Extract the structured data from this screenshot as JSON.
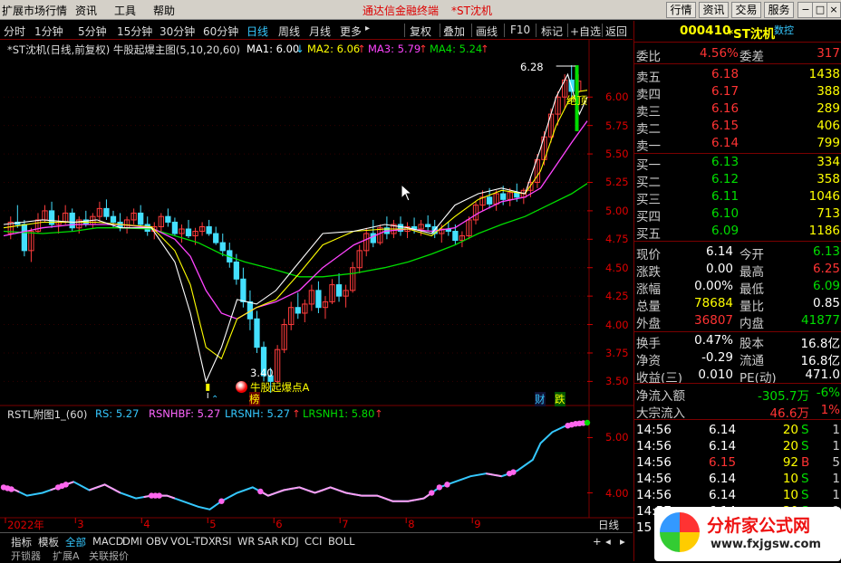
{
  "menubar": {
    "items": [
      "扩展市场行情",
      "资讯",
      "工具",
      "帮助"
    ],
    "title": "通达信金融终端",
    "stock_title": "*ST沈机",
    "buttons": [
      "行情",
      "资讯",
      "交易",
      "服务"
    ],
    "window_controls": [
      "−",
      "□",
      "×"
    ]
  },
  "toolbar": {
    "periods": [
      "分时",
      "1分钟",
      "5分钟",
      "15分钟",
      "30分钟",
      "60分钟",
      "日线",
      "周线",
      "月线",
      "更多"
    ],
    "active_period": "日线",
    "more_arrow": "▸",
    "actions": [
      "复权",
      "叠加",
      "画线",
      "F10",
      "标记",
      "+自选",
      "返回"
    ]
  },
  "main_legend": {
    "title": "*ST沈机(日线,前复权) 牛股起爆主图(5,10,20,60)",
    "ma1": "MA1: 6.00",
    "ma1_arrow": "↓",
    "ma2": "MA2: 6.06",
    "ma2_arrow": "↑",
    "ma3": "MA3: 5.79",
    "ma3_arrow": "↑",
    "ma4": "MA4: 5.24",
    "ma4_arrow": "↑"
  },
  "annotations": {
    "high": "6.28",
    "low": "3.40",
    "signal": "牛股起爆点A",
    "top_tag": "绝顶",
    "bang": "榜",
    "cai": "财",
    "die": "跌"
  },
  "sub_legend": {
    "title": "RSTL附图1_(60)",
    "rs": "RS: 5.27",
    "rsnhbf": "RSNHBF: 5.27",
    "lrsnh": "LRSNH: 5.27",
    "lrsnh_arrow": "↑",
    "lrsnh1": "LRSNH1: 5.80",
    "lrsnh1_arrow": "↑"
  },
  "colors": {
    "up": "#ff3c3c",
    "down": "#44e0ff",
    "ma1": "#ffffff",
    "ma2": "#ffff00",
    "ma3": "#ff44ff",
    "ma4": "#00dd00",
    "axis": "#cc0000"
  },
  "chart_data": {
    "type": "candlestick",
    "price_axis": {
      "ticks": [
        "6.00",
        "5.75",
        "5.50",
        "5.25",
        "5.00",
        "4.75",
        "4.50",
        "4.25",
        "4.00",
        "3.75",
        "3.50"
      ],
      "range": [
        3.4,
        6.28
      ]
    },
    "sub_axis": {
      "ticks": [
        "5.00",
        "4.00"
      ]
    },
    "x_axis": {
      "labels": [
        "2022年",
        "3",
        "4",
        "5",
        "6",
        "7",
        "8",
        "9"
      ],
      "period_label": "日线"
    },
    "ma1_points": [
      [
        0,
        4.88
      ],
      [
        10,
        4.92
      ],
      [
        18,
        4.9
      ],
      [
        24,
        4.92
      ],
      [
        30,
        4.85
      ],
      [
        38,
        4.85
      ],
      [
        44,
        4.55
      ],
      [
        48,
        4.1
      ],
      [
        52,
        3.5
      ],
      [
        56,
        3.8
      ],
      [
        60,
        4.22
      ],
      [
        65,
        4.18
      ],
      [
        70,
        4.3
      ],
      [
        76,
        4.55
      ],
      [
        82,
        4.8
      ],
      [
        90,
        4.82
      ],
      [
        98,
        4.88
      ],
      [
        104,
        4.85
      ],
      [
        110,
        4.8
      ],
      [
        116,
        5.05
      ],
      [
        122,
        5.15
      ],
      [
        128,
        5.2
      ],
      [
        134,
        5.15
      ],
      [
        138,
        5.55
      ],
      [
        142,
        6.0
      ],
      [
        145,
        6.2
      ],
      [
        148,
        5.85
      ],
      [
        150,
        6.0
      ]
    ],
    "ma2_points": [
      [
        0,
        4.85
      ],
      [
        10,
        4.9
      ],
      [
        18,
        4.9
      ],
      [
        24,
        4.9
      ],
      [
        30,
        4.88
      ],
      [
        38,
        4.86
      ],
      [
        44,
        4.65
      ],
      [
        48,
        4.35
      ],
      [
        52,
        3.8
      ],
      [
        56,
        3.7
      ],
      [
        60,
        4.05
      ],
      [
        65,
        4.15
      ],
      [
        70,
        4.22
      ],
      [
        76,
        4.45
      ],
      [
        82,
        4.7
      ],
      [
        90,
        4.82
      ],
      [
        98,
        4.84
      ],
      [
        104,
        4.84
      ],
      [
        110,
        4.78
      ],
      [
        116,
        4.95
      ],
      [
        122,
        5.1
      ],
      [
        128,
        5.18
      ],
      [
        134,
        5.15
      ],
      [
        138,
        5.35
      ],
      [
        142,
        5.75
      ],
      [
        145,
        5.95
      ],
      [
        148,
        6.05
      ],
      [
        150,
        6.06
      ]
    ],
    "ma3_points": [
      [
        0,
        4.78
      ],
      [
        10,
        4.85
      ],
      [
        18,
        4.88
      ],
      [
        24,
        4.88
      ],
      [
        30,
        4.88
      ],
      [
        38,
        4.85
      ],
      [
        44,
        4.75
      ],
      [
        48,
        4.6
      ],
      [
        52,
        4.3
      ],
      [
        56,
        4.1
      ],
      [
        60,
        4.05
      ],
      [
        65,
        4.15
      ],
      [
        70,
        4.2
      ],
      [
        76,
        4.3
      ],
      [
        82,
        4.5
      ],
      [
        90,
        4.7
      ],
      [
        98,
        4.82
      ],
      [
        104,
        4.84
      ],
      [
        110,
        4.82
      ],
      [
        116,
        4.85
      ],
      [
        122,
        4.98
      ],
      [
        128,
        5.08
      ],
      [
        134,
        5.12
      ],
      [
        138,
        5.2
      ],
      [
        142,
        5.4
      ],
      [
        146,
        5.6
      ],
      [
        150,
        5.79
      ]
    ],
    "ma4_points": [
      [
        0,
        4.82
      ],
      [
        10,
        4.8
      ],
      [
        18,
        4.82
      ],
      [
        24,
        4.85
      ],
      [
        30,
        4.85
      ],
      [
        38,
        4.84
      ],
      [
        44,
        4.78
      ],
      [
        50,
        4.72
      ],
      [
        56,
        4.62
      ],
      [
        62,
        4.55
      ],
      [
        70,
        4.48
      ],
      [
        76,
        4.42
      ],
      [
        82,
        4.42
      ],
      [
        90,
        4.45
      ],
      [
        98,
        4.5
      ],
      [
        104,
        4.55
      ],
      [
        110,
        4.62
      ],
      [
        116,
        4.7
      ],
      [
        122,
        4.8
      ],
      [
        128,
        4.88
      ],
      [
        134,
        4.95
      ],
      [
        140,
        5.05
      ],
      [
        146,
        5.15
      ],
      [
        150,
        5.24
      ]
    ],
    "ohlc": [
      [
        4.8,
        4.95,
        4.75,
        4.9
      ],
      [
        4.9,
        5.05,
        4.85,
        4.88
      ],
      [
        4.88,
        4.92,
        4.6,
        4.65
      ],
      [
        4.65,
        4.85,
        4.55,
        4.82
      ],
      [
        4.82,
        4.98,
        4.8,
        4.92
      ],
      [
        4.92,
        5.05,
        4.9,
        5.0
      ],
      [
        5.0,
        5.08,
        4.85,
        4.88
      ],
      [
        4.88,
        4.96,
        4.8,
        4.9
      ],
      [
        4.9,
        5.05,
        4.88,
        4.98
      ],
      [
        4.98,
        5.02,
        4.82,
        4.85
      ],
      [
        4.85,
        4.95,
        4.8,
        4.92
      ],
      [
        4.92,
        5.0,
        4.86,
        4.88
      ],
      [
        4.88,
        4.98,
        4.84,
        4.95
      ],
      [
        4.95,
        5.08,
        4.9,
        5.02
      ],
      [
        5.02,
        5.1,
        4.92,
        4.95
      ],
      [
        4.95,
        5.0,
        4.85,
        4.9
      ],
      [
        4.9,
        4.98,
        4.82,
        4.85
      ],
      [
        4.85,
        4.95,
        4.8,
        4.92
      ],
      [
        4.92,
        5.02,
        4.88,
        4.98
      ],
      [
        4.98,
        5.05,
        4.86,
        4.88
      ],
      [
        4.88,
        4.95,
        4.78,
        4.82
      ],
      [
        4.82,
        4.9,
        4.75,
        4.86
      ],
      [
        4.86,
        4.98,
        4.82,
        4.95
      ],
      [
        4.95,
        5.02,
        4.86,
        4.9
      ],
      [
        4.9,
        4.94,
        4.78,
        4.8
      ],
      [
        4.8,
        4.88,
        4.72,
        4.84
      ],
      [
        4.84,
        4.92,
        4.76,
        4.78
      ],
      [
        4.78,
        4.85,
        4.7,
        4.82
      ],
      [
        4.82,
        4.9,
        4.78,
        4.86
      ],
      [
        4.86,
        4.92,
        4.78,
        4.8
      ],
      [
        4.8,
        4.86,
        4.7,
        4.72
      ],
      [
        4.72,
        4.8,
        4.6,
        4.65
      ],
      [
        4.65,
        4.72,
        4.5,
        4.55
      ],
      [
        4.55,
        4.62,
        4.35,
        4.4
      ],
      [
        4.4,
        4.5,
        4.15,
        4.2
      ],
      [
        4.2,
        4.3,
        3.95,
        4.05
      ],
      [
        4.05,
        4.12,
        3.75,
        3.8
      ],
      [
        3.8,
        3.85,
        3.5,
        3.55
      ],
      [
        3.55,
        3.62,
        3.4,
        3.5
      ],
      [
        3.5,
        3.82,
        3.48,
        3.78
      ],
      [
        3.78,
        4.05,
        3.75,
        4.0
      ],
      [
        4.0,
        4.2,
        3.95,
        4.15
      ],
      [
        4.15,
        4.28,
        4.05,
        4.1
      ],
      [
        4.1,
        4.22,
        4.02,
        4.18
      ],
      [
        4.18,
        4.35,
        4.12,
        4.3
      ],
      [
        4.3,
        4.38,
        4.1,
        4.15
      ],
      [
        4.15,
        4.25,
        4.05,
        4.2
      ],
      [
        4.2,
        4.4,
        4.18,
        4.35
      ],
      [
        4.35,
        4.45,
        4.2,
        4.25
      ],
      [
        4.25,
        4.35,
        4.15,
        4.3
      ],
      [
        4.3,
        4.55,
        4.28,
        4.5
      ],
      [
        4.5,
        4.7,
        4.45,
        4.65
      ],
      [
        4.65,
        4.85,
        4.6,
        4.8
      ],
      [
        4.8,
        4.92,
        4.68,
        4.72
      ],
      [
        4.72,
        4.88,
        4.7,
        4.85
      ],
      [
        4.85,
        4.95,
        4.75,
        4.8
      ],
      [
        4.8,
        4.92,
        4.76,
        4.88
      ],
      [
        4.88,
        4.95,
        4.78,
        4.82
      ],
      [
        4.82,
        4.9,
        4.76,
        4.86
      ],
      [
        4.86,
        4.94,
        4.8,
        4.84
      ],
      [
        4.84,
        4.92,
        4.78,
        4.88
      ],
      [
        4.88,
        4.96,
        4.82,
        4.86
      ],
      [
        4.86,
        4.92,
        4.76,
        4.8
      ],
      [
        4.8,
        4.88,
        4.72,
        4.84
      ],
      [
        4.84,
        4.9,
        4.78,
        4.82
      ],
      [
        4.82,
        4.88,
        4.7,
        4.74
      ],
      [
        4.74,
        4.82,
        4.68,
        4.78
      ],
      [
        4.78,
        4.95,
        4.75,
        4.92
      ],
      [
        4.92,
        5.08,
        4.88,
        5.05
      ],
      [
        5.05,
        5.18,
        5.0,
        5.12
      ],
      [
        5.12,
        5.2,
        5.02,
        5.06
      ],
      [
        5.06,
        5.18,
        5.0,
        5.15
      ],
      [
        5.15,
        5.22,
        5.05,
        5.1
      ],
      [
        5.1,
        5.2,
        5.04,
        5.16
      ],
      [
        5.16,
        5.24,
        5.08,
        5.12
      ],
      [
        5.12,
        5.2,
        5.06,
        5.18
      ],
      [
        5.18,
        5.3,
        5.12,
        5.25
      ],
      [
        5.25,
        5.5,
        5.2,
        5.45
      ],
      [
        5.45,
        5.7,
        5.4,
        5.65
      ],
      [
        5.65,
        5.9,
        5.6,
        5.85
      ],
      [
        5.85,
        6.05,
        5.75,
        6.0
      ],
      [
        6.0,
        6.2,
        5.9,
        6.15
      ],
      [
        6.15,
        6.28,
        5.95,
        6.05
      ],
      [
        6.05,
        6.2,
        5.85,
        6.14
      ]
    ],
    "sub_points": [
      [
        0,
        4.1
      ],
      [
        3,
        4.05
      ],
      [
        6,
        3.95
      ],
      [
        10,
        4.0
      ],
      [
        14,
        4.1
      ],
      [
        18,
        4.2
      ],
      [
        22,
        4.05
      ],
      [
        26,
        4.15
      ],
      [
        30,
        4.0
      ],
      [
        34,
        3.9
      ],
      [
        38,
        3.95
      ],
      [
        42,
        3.95
      ],
      [
        46,
        3.85
      ],
      [
        50,
        3.75
      ],
      [
        53,
        3.7
      ],
      [
        56,
        3.85
      ],
      [
        60,
        4.0
      ],
      [
        64,
        4.1
      ],
      [
        68,
        3.95
      ],
      [
        72,
        4.05
      ],
      [
        76,
        4.1
      ],
      [
        80,
        4.0
      ],
      [
        84,
        4.1
      ],
      [
        88,
        4.0
      ],
      [
        92,
        3.95
      ],
      [
        96,
        3.95
      ],
      [
        100,
        3.85
      ],
      [
        104,
        3.85
      ],
      [
        108,
        3.9
      ],
      [
        112,
        4.1
      ],
      [
        116,
        4.2
      ],
      [
        120,
        4.3
      ],
      [
        124,
        4.35
      ],
      [
        128,
        4.3
      ],
      [
        132,
        4.4
      ],
      [
        136,
        4.6
      ],
      [
        138,
        4.9
      ],
      [
        141,
        5.1
      ],
      [
        144,
        5.2
      ],
      [
        147,
        5.25
      ],
      [
        150,
        5.27
      ]
    ],
    "sub_highlights": [
      0,
      1,
      2,
      14,
      15,
      16,
      38,
      39,
      40,
      56,
      66,
      110,
      112,
      114,
      130,
      131,
      145,
      146,
      147,
      148,
      149,
      150
    ]
  },
  "right_panel": {
    "code": "000410",
    "name": "*ST沈机",
    "tag": "数控",
    "weibi_label": "委比",
    "weibi": "4.56%",
    "weicha_label": "委差",
    "weicha": "317",
    "asks": [
      {
        "label": "卖五",
        "price": "6.18",
        "vol": "1438"
      },
      {
        "label": "卖四",
        "price": "6.17",
        "vol": "388"
      },
      {
        "label": "卖三",
        "price": "6.16",
        "vol": "289"
      },
      {
        "label": "卖二",
        "price": "6.15",
        "vol": "406"
      },
      {
        "label": "卖一",
        "price": "6.14",
        "vol": "799"
      }
    ],
    "bids": [
      {
        "label": "买一",
        "price": "6.13",
        "vol": "334"
      },
      {
        "label": "买二",
        "price": "6.12",
        "vol": "358"
      },
      {
        "label": "买三",
        "price": "6.11",
        "vol": "1046"
      },
      {
        "label": "买四",
        "price": "6.10",
        "vol": "713"
      },
      {
        "label": "买五",
        "price": "6.09",
        "vol": "1186"
      }
    ],
    "stats": [
      {
        "l1": "现价",
        "v1": "6.14",
        "l2": "今开",
        "v2": "6.13"
      },
      {
        "l1": "涨跌",
        "v1": "0.00",
        "l2": "最高",
        "v2": "6.25"
      },
      {
        "l1": "涨幅",
        "v1": "0.00%",
        "l2": "最低",
        "v2": "6.09"
      },
      {
        "l1": "总量",
        "v1": "78684",
        "l2": "量比",
        "v2": "0.85"
      },
      {
        "l1": "外盘",
        "v1": "36807",
        "l2": "内盘",
        "v2": "41877"
      }
    ],
    "stats2": [
      {
        "l1": "换手",
        "v1": "0.47%",
        "l2": "股本",
        "v2": "16.8亿"
      },
      {
        "l1": "净资",
        "v1": "-0.29",
        "l2": "流通",
        "v2": "16.8亿"
      },
      {
        "l1": "收益(三)",
        "v1": "0.010",
        "l2": "PE(动)",
        "v2": "471.0"
      }
    ],
    "flow": [
      {
        "label": "净流入额",
        "value": "-305.7万",
        "pct": "-6%"
      },
      {
        "label": "大宗流入",
        "value": "46.6万",
        "pct": "1%"
      }
    ],
    "ticks": [
      {
        "time": "14:56",
        "price": "6.14",
        "vol": "20",
        "side": "S",
        "n": "1"
      },
      {
        "time": "14:56",
        "price": "6.14",
        "vol": "20",
        "side": "S",
        "n": "1"
      },
      {
        "time": "14:56",
        "price": "6.15",
        "vol": "92",
        "side": "B",
        "n": "5"
      },
      {
        "time": "14:56",
        "price": "6.14",
        "vol": "10",
        "side": "S",
        "n": "1"
      },
      {
        "time": "14:56",
        "price": "6.14",
        "vol": "10",
        "side": "S",
        "n": "1"
      },
      {
        "time": "14:57",
        "price": "6.14",
        "vol": "20",
        "side": "S",
        "n": "1"
      },
      {
        "time": "15",
        "price": "",
        "vol": "",
        "side": "",
        "n": ""
      }
    ]
  },
  "bottom_tabs": {
    "items": [
      "指标",
      "模板",
      "全部",
      "MACD",
      "DMI",
      "OBV",
      "VOL-TDX",
      "RSI",
      "WR",
      "SAR",
      "KDJ",
      "CCI",
      "BOLL"
    ],
    "active": "全部",
    "row2": [
      "开锁器",
      "扩展A",
      "关联报价"
    ],
    "controls": [
      "+",
      "◂",
      "▸"
    ]
  },
  "watermark": {
    "text": "分析家公式网",
    "url": "www.fxjgsw.com"
  }
}
